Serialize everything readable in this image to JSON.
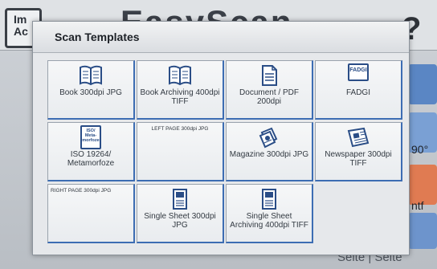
{
  "background": {
    "logo_text": "Im Ac",
    "brand": "EasyScan",
    "help_symbol": "?",
    "side_text_1": "90°",
    "side_text_2": "ntf",
    "bottom_text": "Seite | Seite"
  },
  "dialog": {
    "title": "Scan Templates"
  },
  "tiles": [
    {
      "label": "Book 300dpi JPG",
      "icon": "book-icon"
    },
    {
      "label": "Book Archiving 400dpi TIFF",
      "icon": "book-icon"
    },
    {
      "label": "Document / PDF 200dpi",
      "icon": "document-icon"
    },
    {
      "label": "FADGI",
      "icon": "fadgi-badge-icon",
      "badge_text": "FADGI"
    },
    {
      "label": "ISO 19264/ Metamorfoze",
      "icon": "iso-badge-icon",
      "badge_text": "ISO/ Meta- morfoze"
    },
    {
      "label": "LEFT PAGE 300dpi JPG",
      "icon": ""
    },
    {
      "label": "Magazine 300dpi JPG",
      "icon": "magazine-icon"
    },
    {
      "label": "Newspaper 300dpi TIFF",
      "icon": "newspaper-icon"
    },
    {
      "label": "RIGHT PAGE 300dpi JPG",
      "icon": ""
    },
    {
      "label": "Single Sheet 300dpi JPG",
      "icon": "sheet-image-icon"
    },
    {
      "label": "Single Sheet Archiving 400dpi TIFF",
      "icon": "sheet-image-icon"
    }
  ]
}
